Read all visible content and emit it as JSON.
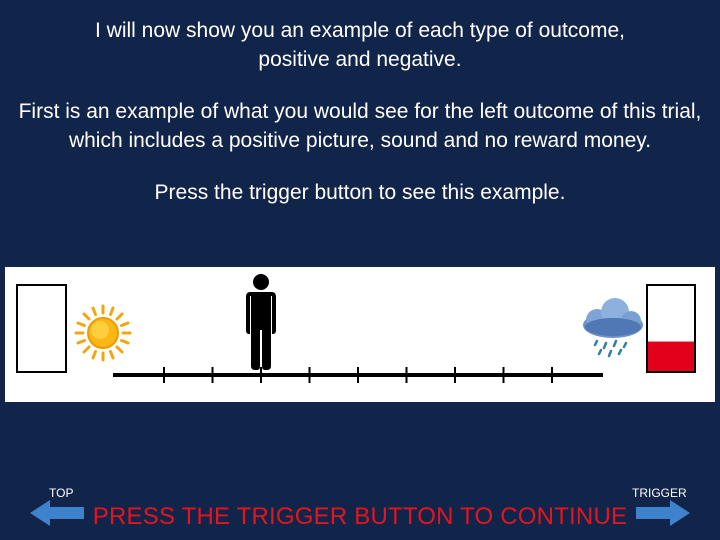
{
  "instructions": {
    "paragraph1": "I will now show you an example of each type of outcome, positive and negative.",
    "paragraph2": "First is an example of what you would see for the left outcome of this trial, which includes a positive picture, sound and no reward money.",
    "paragraph3": "Press the trigger button to see this example."
  },
  "scale": {
    "tick_count": 9,
    "figure_position_tick": 3,
    "left_box_fill_fraction": 0,
    "right_box_fill_fraction": 0.35
  },
  "colors": {
    "background": "#112449",
    "reward_fill": "#e3001b",
    "continue_text": "#e5141e",
    "arrow": "#3f82cc"
  },
  "icons": [
    "sun-icon",
    "person-icon",
    "rain-cloud-icon"
  ],
  "nav": {
    "top_label": "TOP",
    "trigger_label": "TRIGGER",
    "continue_text": "PRESS THE TRIGGER BUTTON TO CONTINUE"
  }
}
